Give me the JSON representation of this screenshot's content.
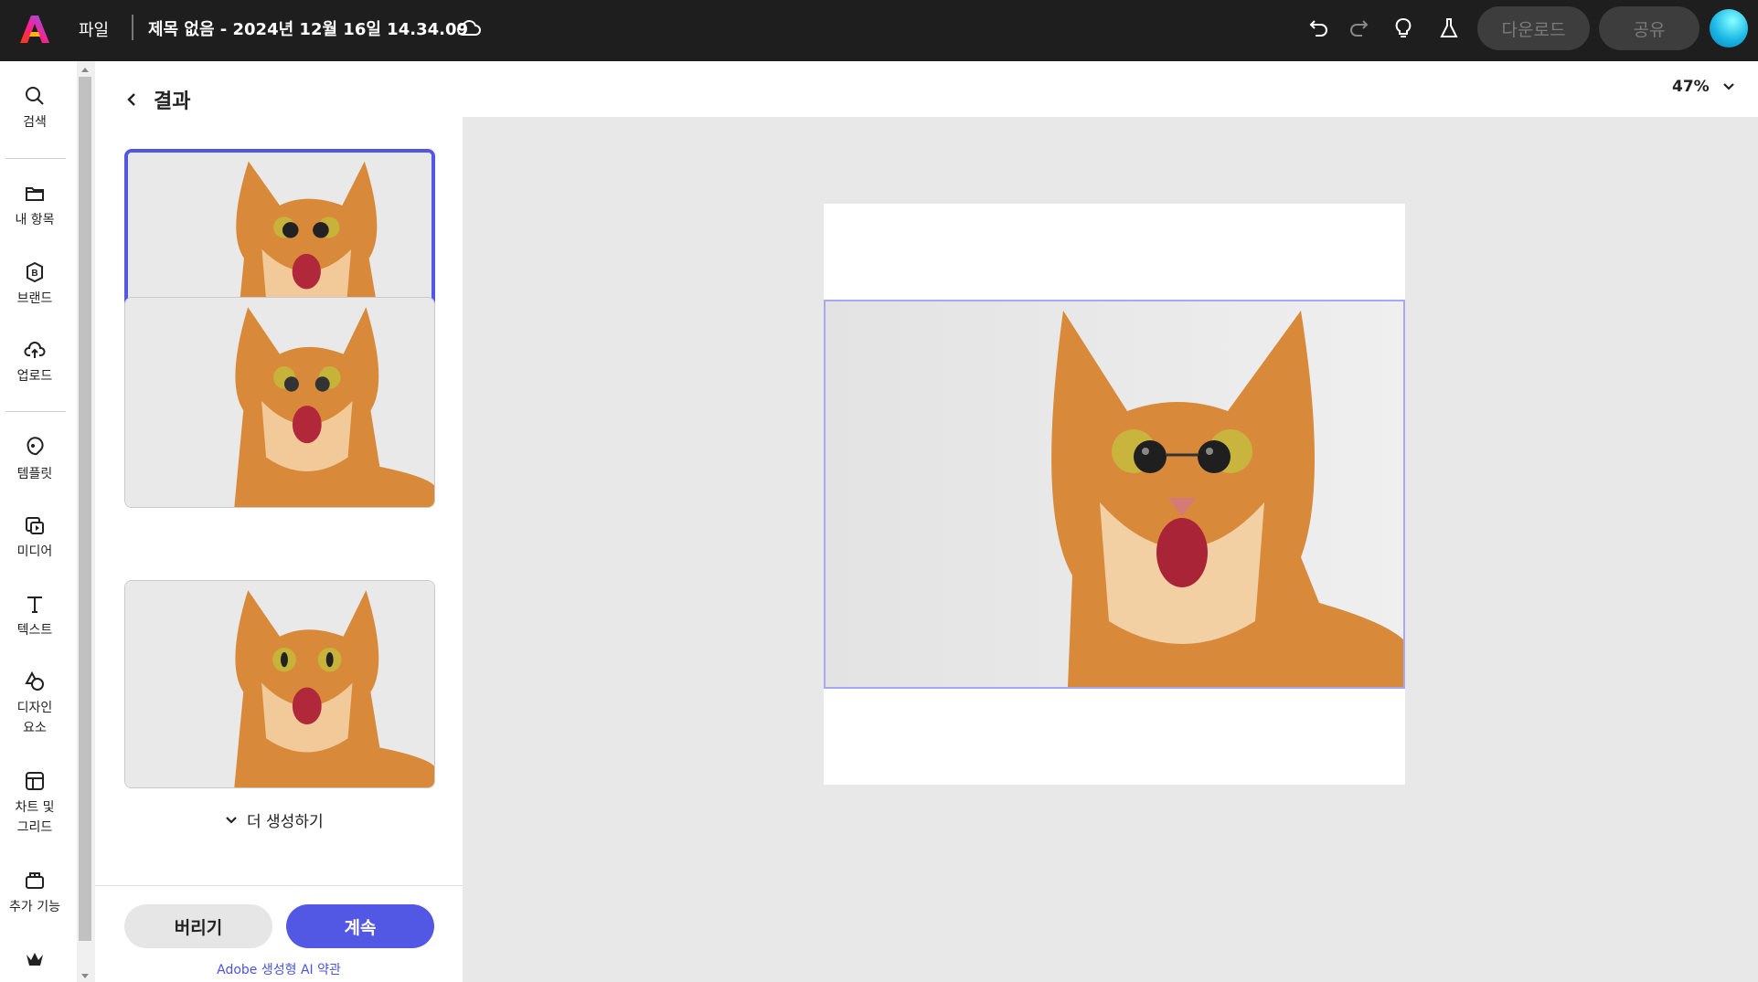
{
  "topbar": {
    "file_menu": "파일",
    "title": "제목 없음 - 2024년 12월 16일 14.34.09",
    "download_label": "다운로드",
    "share_label": "공유"
  },
  "rail": {
    "items": [
      {
        "label": "검색",
        "icon": "search-icon"
      },
      {
        "label": "내 항목",
        "icon": "folder-icon"
      },
      {
        "label": "브랜드",
        "icon": "brand-icon"
      },
      {
        "label": "업로드",
        "icon": "upload-icon"
      },
      {
        "label": "템플릿",
        "icon": "template-icon"
      },
      {
        "label": "미디어",
        "icon": "media-icon"
      },
      {
        "label": "텍스트",
        "icon": "text-icon"
      },
      {
        "label": "디자인\n요소",
        "icon": "shapes-icon"
      },
      {
        "label": "차트 및\n그리드",
        "icon": "grid-icon"
      },
      {
        "label": "추가 기능",
        "icon": "addons-icon"
      }
    ]
  },
  "panel": {
    "title": "결과",
    "more_label": "더 생성하기",
    "discard_label": "버리기",
    "continue_label": "계속",
    "terms_label": "Adobe 생성형 AI 약관"
  },
  "canvas": {
    "zoom": "47%"
  },
  "colors": {
    "accent": "#5258e4",
    "topbar_bg": "#1e1e1e",
    "selection_border": "#a6a8f2"
  }
}
